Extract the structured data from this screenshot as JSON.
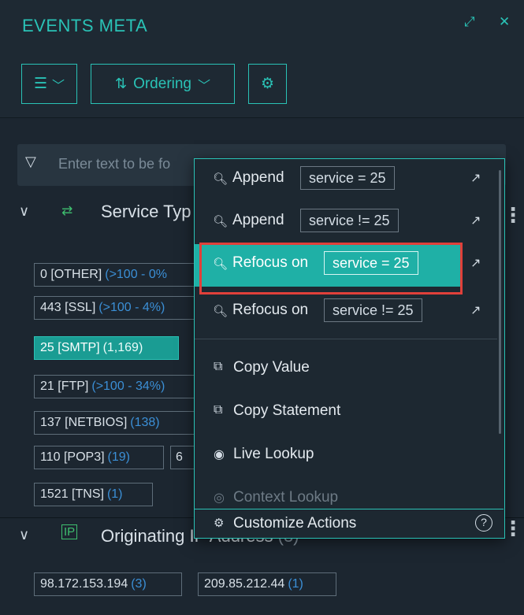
{
  "panel": {
    "title": "EVENTS META",
    "expand_icon": "expand-icon",
    "close_icon": "close-icon"
  },
  "toolbar": {
    "ordering_label": "Ordering",
    "view_icon": "list-view-icon",
    "settings_icon": "gear-icon"
  },
  "filter": {
    "placeholder": "Enter text to be fo"
  },
  "sections": [
    {
      "title": "Service Typ",
      "values": [
        {
          "label": "0 [OTHER]",
          "count": "(>100 - 0%"
        },
        {
          "label": "443 [SSL]",
          "count": "(>100 - 4%)"
        },
        {
          "label": "25 [SMTP]",
          "count": "(1,169)",
          "selected": true
        },
        {
          "label": "21 [FTP]",
          "count": "(>100 - 34%)"
        },
        {
          "label": "137 [NETBIOS]",
          "count": "(138)"
        },
        {
          "label": "110 [POP3]",
          "count": "(19)"
        },
        {
          "label": "6",
          "count": ""
        },
        {
          "label": "1521 [TNS]",
          "count": "(1)"
        }
      ]
    },
    {
      "title": "Originating IP Address",
      "title_suffix": "(3)",
      "values": [
        {
          "label": "98.172.153.194",
          "count": "(3)"
        },
        {
          "label": "209.85.212.44",
          "count": "(1)"
        }
      ]
    }
  ],
  "menu": {
    "query_items": [
      {
        "label": "Append",
        "value": "service = 25"
      },
      {
        "label": "Append",
        "value": "service != 25"
      },
      {
        "label": "Refocus on",
        "value": "service = 25",
        "highlighted": true
      },
      {
        "label": "Refocus on",
        "value": "service != 25"
      }
    ],
    "actions": [
      {
        "label": "Copy Value",
        "icon": "copy-icon"
      },
      {
        "label": "Copy Statement",
        "icon": "copy-icon"
      },
      {
        "label": "Live Lookup",
        "icon": "live-icon"
      },
      {
        "label": "Context Lookup",
        "icon": "context-lookup-icon",
        "disabled": true
      }
    ],
    "footer_label": "Customize Actions",
    "help_symbol": "?"
  },
  "colors": {
    "accent": "#2ac2b6",
    "highlight": "#1fb0a6",
    "annotation_red": "#e0403a",
    "count_blue": "#3b8fd6"
  }
}
